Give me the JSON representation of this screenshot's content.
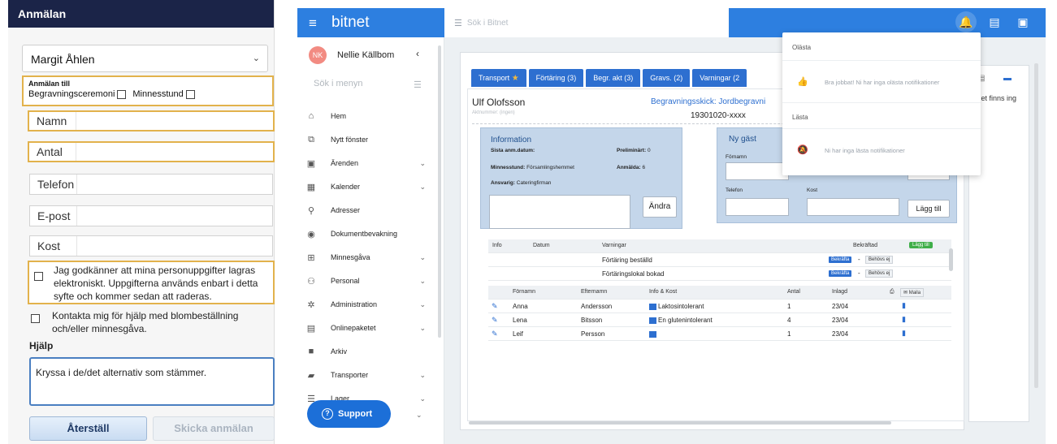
{
  "form": {
    "header": "Anmälan",
    "selected_person": "Margit Åhlen",
    "registration": {
      "title": "Anmälan till",
      "option1": "Begravningsceremoni",
      "option2": "Minnesstund"
    },
    "fields": {
      "name": "Namn",
      "count": "Antal",
      "phone": "Telefon",
      "email": "E-post",
      "diet": "Kost"
    },
    "consent": "Jag godkänner att mina personuppgifter lagras elektroniskt. Uppgifterna används enbart i detta syfte och kommer sedan att raderas.",
    "contact": "Kontakta mig för hjälp med blombeställning och/eller minnesgåva.",
    "help_title": "Hjälp",
    "help_text": "Kryssa i de/det alternativ som stämmer.",
    "reset": "Återställ",
    "send": "Skicka anmälan"
  },
  "app": {
    "brand": "bitnet",
    "search_placeholder": "Sök i Bitnet",
    "user_initials": "NK",
    "user_name": "Nellie Källbom",
    "menu_search": "Sök i menyn",
    "menu": [
      {
        "label": "Hem",
        "icon": "home-icon",
        "glyph": "⌂",
        "chevron": false
      },
      {
        "label": "Nytt fönster",
        "icon": "new-window-icon",
        "glyph": "⧉",
        "chevron": false
      },
      {
        "label": "Ärenden",
        "icon": "cases-icon",
        "glyph": "▣",
        "chevron": true
      },
      {
        "label": "Kalender",
        "icon": "calendar-icon",
        "glyph": "▦",
        "chevron": true
      },
      {
        "label": "Adresser",
        "icon": "pin-icon",
        "glyph": "⚲",
        "chevron": false
      },
      {
        "label": "Dokumentbevakning",
        "icon": "document-watch-icon",
        "glyph": "◉",
        "chevron": false
      },
      {
        "label": "Minnesgåva",
        "icon": "gift-icon",
        "glyph": "⊞",
        "chevron": true
      },
      {
        "label": "Personal",
        "icon": "people-icon",
        "glyph": "⚇",
        "chevron": true
      },
      {
        "label": "Administration",
        "icon": "gear-icon",
        "glyph": "✲",
        "chevron": true
      },
      {
        "label": "Onlinepaketet",
        "icon": "package-icon",
        "glyph": "▤",
        "chevron": true
      },
      {
        "label": "Arkiv",
        "icon": "archive-icon",
        "glyph": "■",
        "chevron": false
      },
      {
        "label": "Transporter",
        "icon": "truck-icon",
        "glyph": "▰",
        "chevron": true
      },
      {
        "label": "Lager",
        "icon": "list-icon",
        "glyph": "☰",
        "chevron": true
      }
    ],
    "support": "Support",
    "tabs": [
      "Transport",
      "Förtäring (3)",
      "Begr. akt (3)",
      "Gravs. (2)",
      "Varningar (2"
    ],
    "person_name": "Ulf Olofsson",
    "person_sub": "Aktnummer: (ingen)",
    "delivery": "Begravningsskick: Jordbegravni",
    "pnr": "19301020-xxxx",
    "info": {
      "title": "Information",
      "sista_label": "Sista anm.datum:",
      "prelim_label": "Preliminärt:",
      "prelim_value": "0",
      "minnesstund_label": "Minnesstund:",
      "minnesstund_value": "Församlingshemmet",
      "anmalda_label": "Anmälda:",
      "anmalda_value": "6",
      "ansvarig_label": "Ansvarig:",
      "ansvarig_value": "Cateringfirman",
      "edit": "Ändra"
    },
    "guest": {
      "title": "Ny gäst",
      "firstname": "Förnamn",
      "phone": "Telefon",
      "diet": "Kost",
      "add": "Lägg till"
    },
    "warnings": {
      "headers": [
        "Info",
        "Datum",
        "Varningar",
        "Bekräftad"
      ],
      "add_btn": "Lägg till",
      "rows": [
        "Förtäring beställd",
        "Förtäringslokal bokad"
      ],
      "confirm": "Bekräfta",
      "dash": "-",
      "not_needed": "Behövs ej"
    },
    "guests_table": {
      "headers": [
        "Förnamn",
        "Efternamn",
        "Info & Kost",
        "Antal",
        "Inlagd"
      ],
      "print": "⎙",
      "mail": "✉ Maila",
      "rows": [
        {
          "first": "Anna",
          "last": "Andersson",
          "diet": "Laktosintolerant",
          "count": "1",
          "date": "23/04"
        },
        {
          "first": "Lena",
          "last": "Bitsson",
          "diet": "En glutenintolerant",
          "count": "4",
          "date": "23/04"
        },
        {
          "first": "Leif",
          "last": "Persson",
          "diet": "",
          "count": "1",
          "date": "23/04"
        }
      ]
    },
    "side_text": "Det finns ing",
    "notifications": {
      "unread_title": "Olästa",
      "unread_msg": "Bra jobbat! Ni har inga olästa notifikationer",
      "read_title": "Lästa",
      "read_msg": "Ni har inga lästa notifikationer"
    }
  }
}
